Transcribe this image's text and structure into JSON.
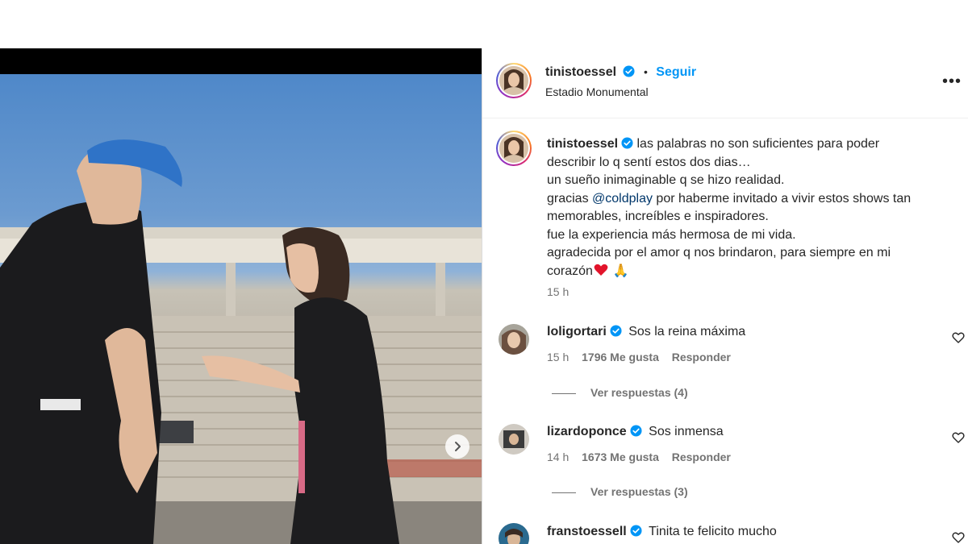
{
  "post": {
    "username": "tinistoessel",
    "follow_label": "Seguir",
    "separator": "•",
    "location": "Estadio Monumental",
    "more_label": "•••"
  },
  "caption": {
    "username": "tinistoessel",
    "line1": "las palabras no son suficientes para poder",
    "line2": "describir lo q sentí estos dos dias…",
    "line3": "un sueño inimaginable q se hizo realidad.",
    "line4_pre": "gracias ",
    "line4_mention": "@coldplay",
    "line4_post": " por haberme invitado a vivir estos shows tan",
    "line5": "memorables, increíbles e inspiradores.",
    "line6": "fue la experiencia más hermosa de mi vida.",
    "line7": "agradecida por el amor q nos brindaron, para siempre en mi",
    "line8": "corazón",
    "emoji": "🙏",
    "time": "15 h"
  },
  "comments": [
    {
      "username": "loligortari",
      "text": "Sos la reina máxima",
      "time": "15 h",
      "likes": "1796 Me gusta",
      "reply": "Responder",
      "view_replies": "Ver respuestas (4)"
    },
    {
      "username": "lizardoponce",
      "text": "Sos inmensa",
      "time": "14 h",
      "likes": "1673 Me gusta",
      "reply": "Responder",
      "view_replies": "Ver respuestas (3)"
    },
    {
      "username": "franstoessell",
      "text": "Tinita te felicito mucho"
    }
  ],
  "colors": {
    "accent": "#0095f6",
    "verified": "#0095f6",
    "mention": "#00376b",
    "muted": "#737373"
  },
  "icons": {
    "next": "chevron-right-icon",
    "heart": "heart-outline-icon",
    "verified": "verified-badge-icon",
    "more": "more-horizontal-icon"
  }
}
